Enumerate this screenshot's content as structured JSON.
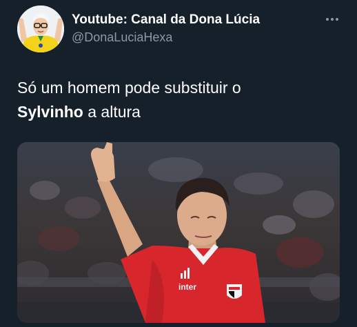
{
  "tweet": {
    "author": {
      "display_name": "Youtube: Canal da Dona Lúcia",
      "handle": "@DonaLuciaHexa"
    },
    "text_line1": "Só um homem pode substituir o",
    "text_bold": "Sylvinho",
    "text_rest": " a altura",
    "media": {
      "shirt_brand": "adidas",
      "shirt_sponsor": "inter"
    }
  },
  "icons": {
    "more": "more-horizontal-icon"
  },
  "colors": {
    "background": "#15202b",
    "text_primary": "#ffffff",
    "text_secondary": "#8b98a5",
    "shirt_red": "#d8262d"
  }
}
